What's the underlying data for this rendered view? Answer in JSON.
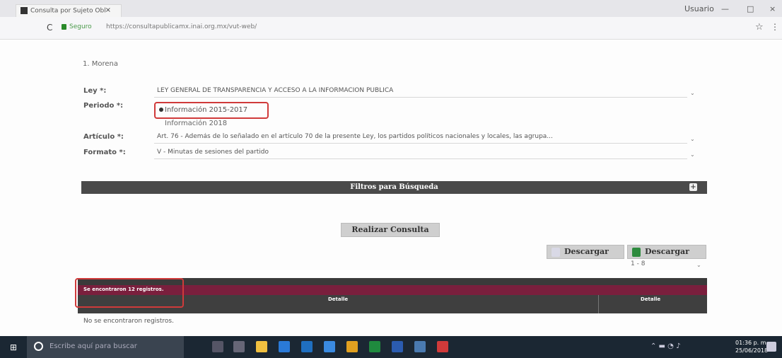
{
  "browser": {
    "tab_title": "Consulta por Sujeto Obl",
    "tab_close": "×",
    "user_name": "Usuario",
    "minimize": "—",
    "maximize": "□",
    "close": "×",
    "reload": "C",
    "secure_label": "Seguro",
    "url": "https://consultapublicamx.inai.org.mx/vut-web/",
    "star": "☆",
    "menu": "⋮"
  },
  "form": {
    "subject": "1. Morena",
    "ley_label": "Ley *:",
    "ley_value": "LEY GENERAL DE TRANSPARENCIA Y ACCESO A LA INFORMACION PUBLICA",
    "periodo_label": "Periodo *:",
    "periodo_selected": "Información 2015-2017",
    "periodo_other": "Información 2018",
    "articulo_label": "Artículo *:",
    "articulo_value": "Art. 76 - Además de lo señalado en el artículo 70 de la presente Ley, los partidos políticos nacionales y locales, las agrupa...",
    "formato_label": "Formato *:",
    "formato_value": "V - Minutas de sesiones del partido",
    "dropdown_arrow": "⌄"
  },
  "filters": {
    "title": "Filtros para Búsqueda",
    "plus": "+"
  },
  "actions": {
    "consult": "Realizar Consulta",
    "download_1": "Descargar",
    "download_2": "Descargar",
    "pager": "1 - 8"
  },
  "results": {
    "count_text": "Se encontraron 12 registros.",
    "col_1": "Detalle",
    "col_2": "Detalle",
    "empty": "No se encontraron registros."
  },
  "taskbar": {
    "search_placeholder": "Escribe aquí para buscar",
    "time": "01:36 p. m.",
    "date": "25/06/2018"
  },
  "colors": {
    "highlight": "#d03a3a",
    "results_bar": "#7a1f3d",
    "dark_bar": "#4a4a4a"
  }
}
